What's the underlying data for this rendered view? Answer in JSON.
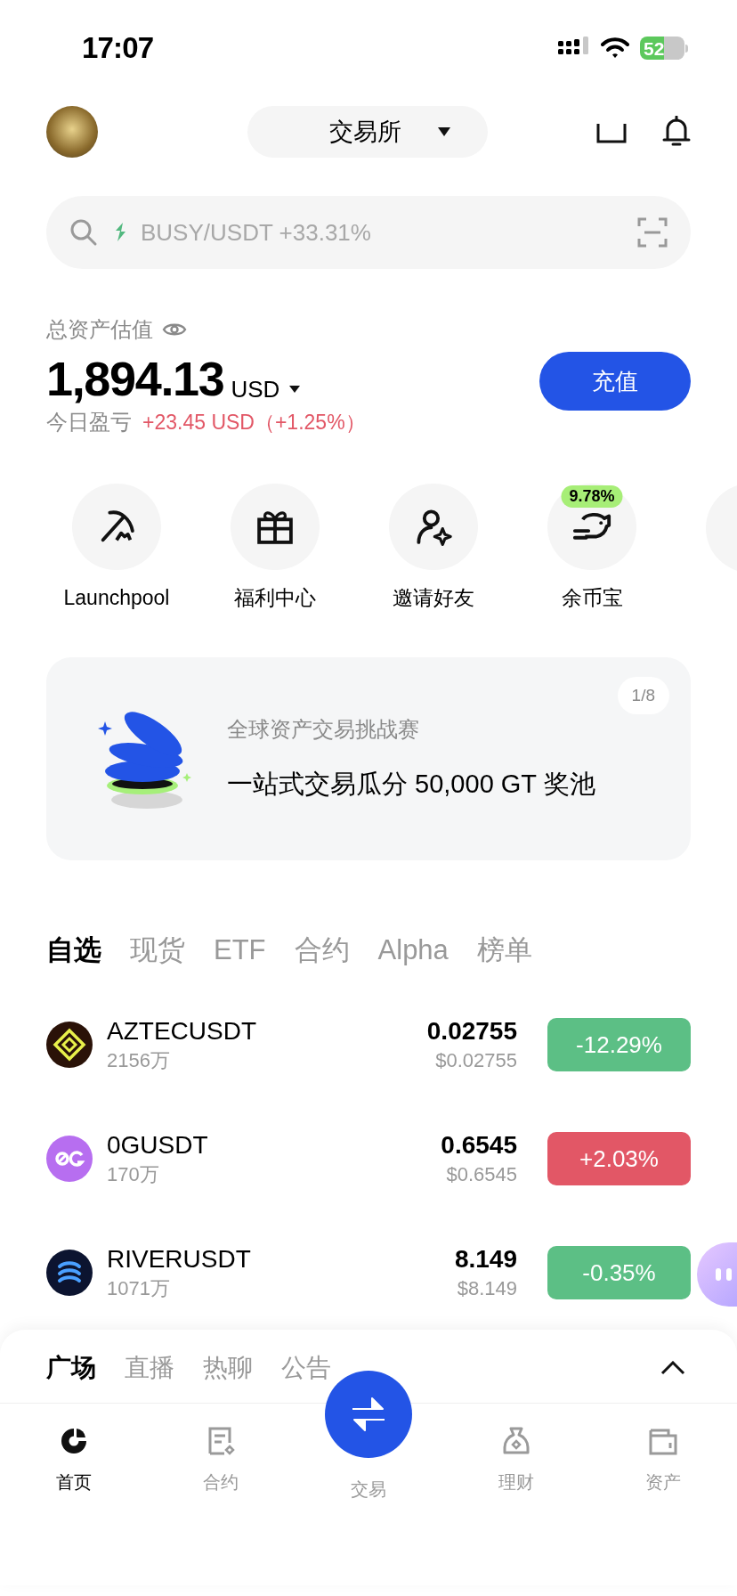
{
  "status_bar": {
    "time": "17:07",
    "battery": "52"
  },
  "header": {
    "exchange_selector": "交易所"
  },
  "search": {
    "placeholder": "BUSY/USDT +33.31%"
  },
  "balance": {
    "label": "总资产估值",
    "amount": "1,894.13",
    "currency": "USD",
    "pnl_label": "今日盈亏",
    "pnl_value": "+23.45 USD（+1.25%）",
    "deposit_button": "充值"
  },
  "shortcuts": [
    {
      "kind": "launchpool",
      "label": "Launchpool"
    },
    {
      "kind": "gift",
      "label": "福利中心"
    },
    {
      "kind": "invite",
      "label": "邀请好友"
    },
    {
      "kind": "savings",
      "label": "余币宝",
      "badge": "9.78%"
    },
    {
      "kind": "more"
    }
  ],
  "banner": {
    "subtitle": "全球资产交易挑战赛",
    "title": "一站式交易瓜分 50,000 GT 奖池",
    "page": "1/8"
  },
  "market_tabs": [
    {
      "label": "自选",
      "selected": true
    },
    {
      "label": "现货",
      "selected": false
    },
    {
      "label": "ETF",
      "selected": false
    },
    {
      "label": "合约",
      "selected": false
    },
    {
      "label": "Alpha",
      "selected": false
    },
    {
      "label": "榜单",
      "selected": false
    }
  ],
  "market_rows": [
    {
      "kind": "aztec",
      "symbol": "AZTECUSDT",
      "volume": "2156万",
      "price": "0.02755",
      "price_usd": "$0.02755",
      "change": "-12.29%",
      "color": "#5cbf85"
    },
    {
      "kind": "og",
      "symbol": "0GUSDT",
      "volume": "170万",
      "price": "0.6545",
      "price_usd": "$0.6545",
      "change": "+2.03%",
      "color": "#e25766"
    },
    {
      "kind": "river",
      "symbol": "RIVERUSDT",
      "volume": "1071万",
      "price": "8.149",
      "price_usd": "$8.149",
      "change": "-0.35%",
      "color": "#5cbf85"
    }
  ],
  "feed_tabs": [
    {
      "label": "广场",
      "selected": true
    },
    {
      "label": "直播",
      "selected": false
    },
    {
      "label": "热聊",
      "selected": false
    },
    {
      "label": "公告",
      "selected": false
    }
  ],
  "bottom_nav": [
    {
      "kind": "home",
      "label": "首页",
      "selected": true
    },
    {
      "kind": "futures",
      "label": "合约",
      "selected": false
    },
    {
      "kind": "trade",
      "label": "交易",
      "selected": false
    },
    {
      "kind": "earn",
      "label": "理财",
      "selected": false
    },
    {
      "kind": "assets",
      "label": "资产",
      "selected": false
    }
  ]
}
